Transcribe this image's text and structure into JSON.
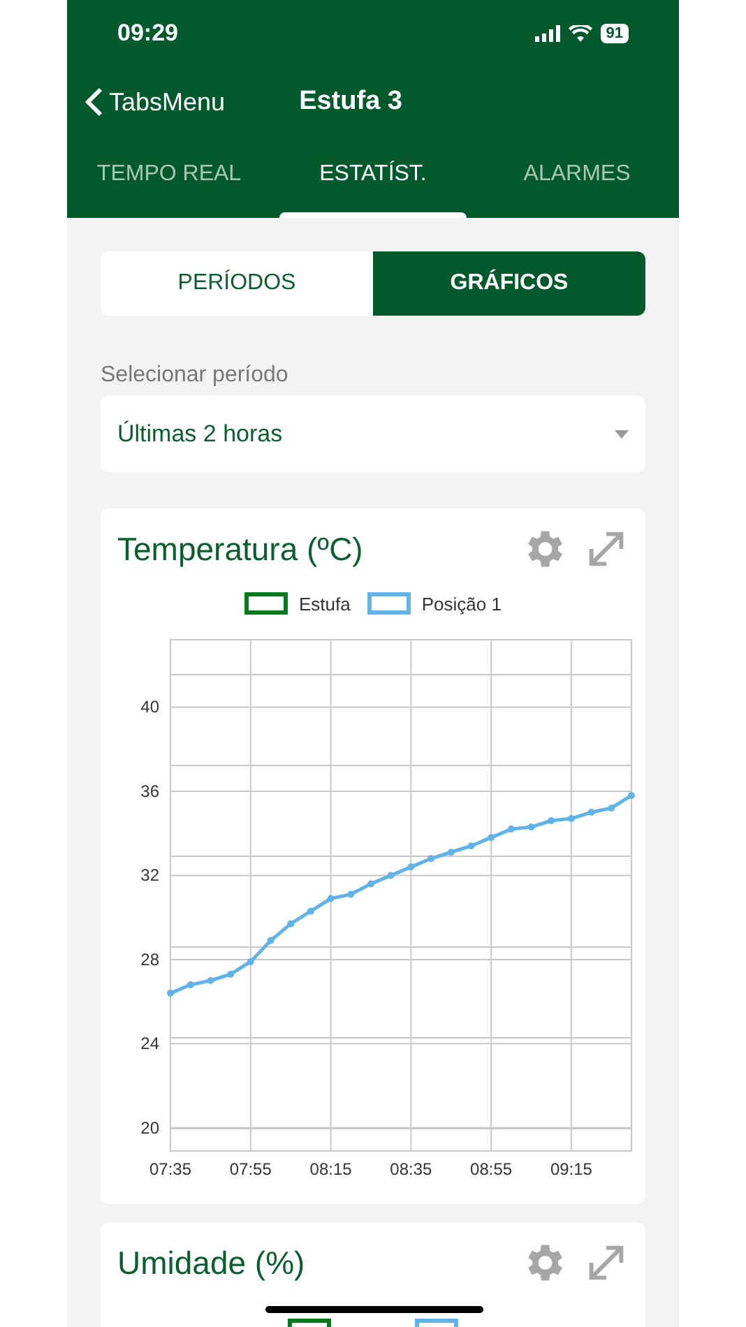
{
  "status_bar": {
    "time": "09:29",
    "battery": "91"
  },
  "nav": {
    "back": "TabsMenu",
    "title": "Estufa 3"
  },
  "tabs": [
    {
      "label": "TEMPO REAL",
      "selected": false
    },
    {
      "label": "ESTATÍST.",
      "selected": true
    },
    {
      "label": "ALARMES",
      "selected": false
    }
  ],
  "segments": [
    {
      "label": "PERÍODOS",
      "selected": false
    },
    {
      "label": "GRÁFICOS",
      "selected": true
    }
  ],
  "period": {
    "label": "Selecionar período",
    "value": "Últimas 2 horas"
  },
  "cards": [
    {
      "title": "Temperatura (ºC)",
      "chart_data": {
        "type": "line",
        "grid": true,
        "x": [
          455,
          460,
          465,
          470,
          475,
          480,
          485,
          490,
          495,
          500,
          505,
          510,
          515,
          520,
          525,
          530,
          535,
          540,
          545,
          550,
          555,
          560,
          565,
          570
        ],
        "series": [
          {
            "name": "Estufa",
            "color": "#007a1a",
            "values": [
              null,
              null,
              null,
              null,
              null,
              null,
              null,
              null,
              null,
              null,
              null,
              null,
              null,
              null,
              null,
              null,
              null,
              null,
              null,
              null,
              null,
              null,
              null,
              null
            ]
          },
          {
            "name": "Posição 1",
            "color": "#5fb3e8",
            "marker": true,
            "values": [
              26.4,
              26.8,
              27.0,
              27.3,
              27.9,
              28.9,
              29.7,
              30.3,
              30.9,
              31.1,
              31.6,
              32.0,
              32.4,
              32.8,
              33.1,
              33.4,
              33.8,
              34.2,
              34.3,
              34.6,
              34.7,
              35.0,
              35.2,
              35.8
            ]
          }
        ],
        "xlim": [
          455,
          570
        ],
        "ylim": [
          18.9,
          43.2
        ],
        "yticks": [
          20,
          24,
          28,
          32,
          36,
          40
        ],
        "xticks": [
          {
            "value": 455,
            "label": "07:35"
          },
          {
            "value": 475,
            "label": "07:55"
          },
          {
            "value": 495,
            "label": "08:15"
          },
          {
            "value": 515,
            "label": "08:35"
          },
          {
            "value": 535,
            "label": "08:55"
          },
          {
            "value": 555,
            "label": "09:15"
          }
        ]
      }
    },
    {
      "title": "Umidade (%)",
      "legend": [
        {
          "color": "#007a1a"
        },
        {
          "color": "#5fb3e8"
        }
      ]
    }
  ]
}
